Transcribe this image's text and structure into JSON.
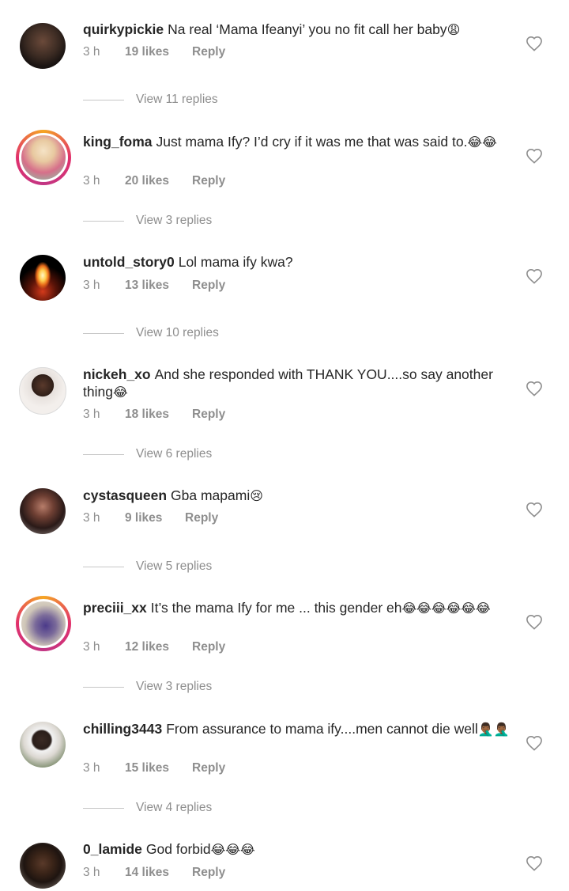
{
  "comments": [
    {
      "username": "quirkypickie",
      "text": "Na real ‘Mama Ifeanyi’ you no fit call her baby",
      "emoji": "😩",
      "time": "3 h",
      "likes": "19 likes",
      "reply": "Reply",
      "view_replies": "View 11 replies"
    },
    {
      "username": "king_foma",
      "text": "Just mama Ify? I’d cry if it was me that was said to.",
      "emoji": "😂😂",
      "time": "3 h",
      "likes": "20 likes",
      "reply": "Reply",
      "view_replies": "View 3 replies"
    },
    {
      "username": "untold_story0",
      "text": "Lol mama ify kwa?",
      "emoji": "",
      "time": "3 h",
      "likes": "13 likes",
      "reply": "Reply",
      "view_replies": "View 10 replies"
    },
    {
      "username": "nickeh_xo",
      "text": "And she responded with THANK YOU....so say another thing",
      "emoji": "😂",
      "time": "3 h",
      "likes": "18 likes",
      "reply": "Reply",
      "view_replies": "View 6 replies"
    },
    {
      "username": "cystasqueen",
      "text": "Gba mapami",
      "emoji": "😢",
      "time": "3 h",
      "likes": "9 likes",
      "reply": "Reply",
      "view_replies": "View 5 replies"
    },
    {
      "username": "preciii_xx",
      "text": "It’s the mama Ify for me ... this gender eh",
      "emoji": "😂😂😂😂😂😂",
      "time": "3 h",
      "likes": "12 likes",
      "reply": "Reply",
      "view_replies": "View 3 replies"
    },
    {
      "username": "chilling3443",
      "text": "From assurance to mama ify....men cannot die well",
      "emoji": "🤦🏾‍♂️🤦🏾‍♂️",
      "time": "3 h",
      "likes": "15 likes",
      "reply": "Reply",
      "view_replies": "View 4 replies"
    },
    {
      "username": "0_lamide",
      "text": "God forbid",
      "emoji": "😂😂😂",
      "time": "3 h",
      "likes": "14 likes",
      "reply": "Reply",
      "view_replies": ""
    }
  ]
}
